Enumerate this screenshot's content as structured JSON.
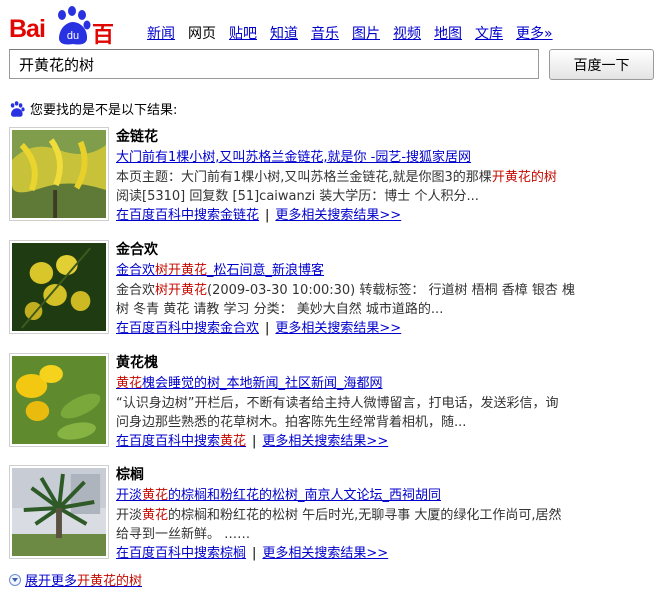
{
  "logo": {
    "text_bai": "Bai",
    "text_du": "du",
    "text_cn": "百度"
  },
  "nav": {
    "items": [
      {
        "label": "新闻",
        "current": false
      },
      {
        "label": "网页",
        "current": true
      },
      {
        "label": "贴吧",
        "current": false
      },
      {
        "label": "知道",
        "current": false
      },
      {
        "label": "音乐",
        "current": false
      },
      {
        "label": "图片",
        "current": false
      },
      {
        "label": "视频",
        "current": false
      },
      {
        "label": "地图",
        "current": false
      },
      {
        "label": "文库",
        "current": false
      },
      {
        "label": "更多»",
        "current": false
      }
    ]
  },
  "search": {
    "value": "开黄花的树",
    "button_label": "百度一下"
  },
  "suggest": {
    "text": "您要找的是不是以下结果:"
  },
  "results": [
    {
      "title": "金链花",
      "link_pre": "大门前有1棵小树,又叫苏格兰金链花,就是你 -园艺-搜狐家居网",
      "link_em": "",
      "link_post": "",
      "desc1_pre": "本页主题：大门前有1棵小树,又叫苏格兰金链花,就是你图3的那棵",
      "desc1_em": "开黄花的树",
      "desc2": "阅读[5310] 回复数 [51]caiwanzi 装大学历：博士 个人积分...",
      "foot_baike_pre": "在百度百科中搜索金链花",
      "foot_baike_em": "",
      "foot_more": "更多相关搜索结果>>"
    },
    {
      "title": "金合欢",
      "link_pre": "金合欢",
      "link_em": "树开黄花",
      "link_post": "_松石间意_新浪博客",
      "desc1_pre": "金合欢",
      "desc1_em": "树开黄花",
      "desc1_post": "(2009-03-30 10:00:30) 转载标签： 行道树 梧桐 香樟 银杏 槐",
      "desc2": "树 冬青 黄花 请教 学习 分类： 美妙大自然 城市道路的...",
      "foot_baike_pre": "在百度百科中搜索金合欢",
      "foot_baike_em": "",
      "foot_more": "更多相关搜索结果>>"
    },
    {
      "title": "黄花槐",
      "link_pre": "",
      "link_em": "黄花",
      "link_post": "槐会睡觉的树_本地新闻_社区新闻_海都网",
      "desc1_pre": "“认识身边树”开栏后，不断有读者给主持人微博留言，打电话，发送彩信，询",
      "desc1_em": "",
      "desc2": "问身边那些熟悉的花草树木。拍客陈先生经常背着相机，随...",
      "foot_baike_pre": "在百度百科中搜索",
      "foot_baike_em": "黄花",
      "foot_more": "更多相关搜索结果>>"
    },
    {
      "title": "棕榈",
      "link_pre": "开淡",
      "link_em": "黄花",
      "link_post": "的棕榈和粉红花的松树_南京人文论坛_西祠胡同",
      "desc1_pre": "开淡",
      "desc1_em": "黄花",
      "desc1_post": "的棕榈和粉红花的松树 午后时光,无聊寻事 大厦的绿化工作尚可,居然",
      "desc2": "给寻到一丝新鲜。 ……",
      "foot_baike_pre": "在百度百科中搜索棕榈",
      "foot_baike_em": "",
      "foot_more": "更多相关搜索结果>>"
    }
  ],
  "more": {
    "pre": "展开更多",
    "em": "开黄花的树"
  },
  "colors": {
    "brand_red": "#e10602",
    "paw_blue": "#2932e1",
    "link": "#0000cc",
    "highlight": "#c60a00"
  }
}
